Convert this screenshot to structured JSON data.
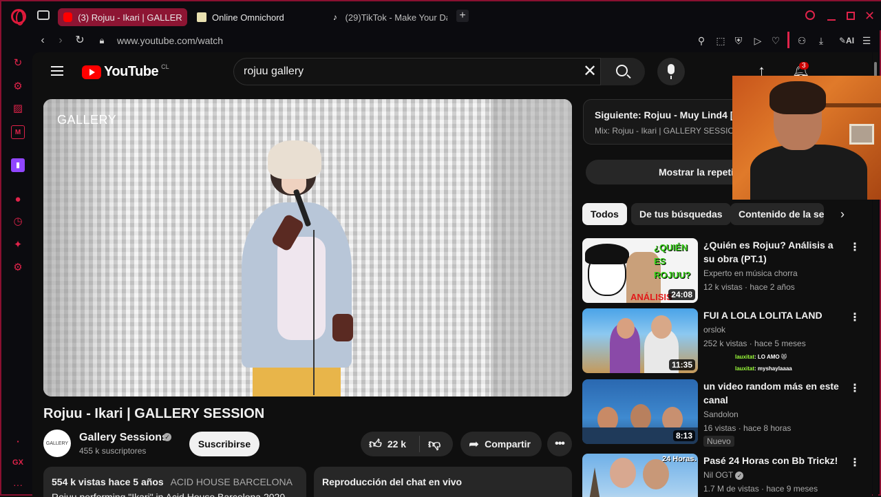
{
  "browser": {
    "tabs": [
      {
        "label": "(3) Rojuu - Ikari | GALLERY",
        "active": true,
        "favicon": "youtube-icon"
      },
      {
        "label": "Online Omnichord",
        "active": false,
        "favicon": "omnichord-icon"
      },
      {
        "label": "(29)TikTok - Make Your Da",
        "active": false,
        "favicon": "tiktok-icon"
      }
    ],
    "new_tab": "+",
    "url": "www.youtube.com/watch",
    "ai_label": "AI",
    "sidebar_label": "GX"
  },
  "header": {
    "logo_text": "YouTube",
    "country_code": "CL",
    "search_value": "rojuu gallery",
    "notification_count": "3"
  },
  "video": {
    "watermark": "GALLERY",
    "title": "Rojuu - Ikari | GALLERY SESSION",
    "channel": "Gallery Sessions",
    "channel_avatar_text": "GALLERY",
    "subscribers": "455 k suscriptores",
    "subscribe_label": "Suscribirse",
    "likes": "22 k",
    "share_label": "Compartir",
    "description_stats": "554 k vistas  hace 5 años",
    "description_tag": "ACID HOUSE BARCELONA",
    "description_text": "Rojuu performing \"Ikari\" in Acid House Barcelona 2020",
    "live_chat_label": "Reproducción del chat en vivo"
  },
  "up_next": {
    "title": "Siguiente: Rojuu - Muy Lind4 [Pro",
    "subtitle": "Mix: Rojuu - Ikari | GALLERY SESSION",
    "show_chat_label": "Mostrar la repetic"
  },
  "chips": [
    "Todos",
    "De tus búsquedas",
    "Contenido de la ser"
  ],
  "recommendations": [
    {
      "title": "¿Quién es Rojuu? Análisis a su obra (PT.1)",
      "channel": "Experto en música chorra",
      "meta": "12 k vistas · hace 2 años",
      "duration": "24:08",
      "thumb_text": "¿QUIÉN ES ROJUU?",
      "thumb_subtext": "ANÁLISIS"
    },
    {
      "title": "FUI A LOLA LOLITA LAND",
      "channel": "orslok",
      "meta": "252 k vistas · hace 5 meses",
      "duration": "11:35"
    },
    {
      "title": "un video random más en este canal",
      "channel": "Sandolon",
      "meta": "16 vistas · hace 8 horas",
      "duration": "8:13",
      "badge": "Nuevo"
    },
    {
      "title": "Pasé 24 Horas con Bb Trickz!",
      "channel": "Nil OGT",
      "meta": "1.7 M de vistas · hace 9 meses",
      "thumb_text": "24 Horas."
    }
  ],
  "stream_chat": [
    {
      "user": "lauxitat",
      "message": ": LO AMO 😻"
    },
    {
      "user": "lauxitat",
      "message": ": myshaylaaaa"
    }
  ]
}
